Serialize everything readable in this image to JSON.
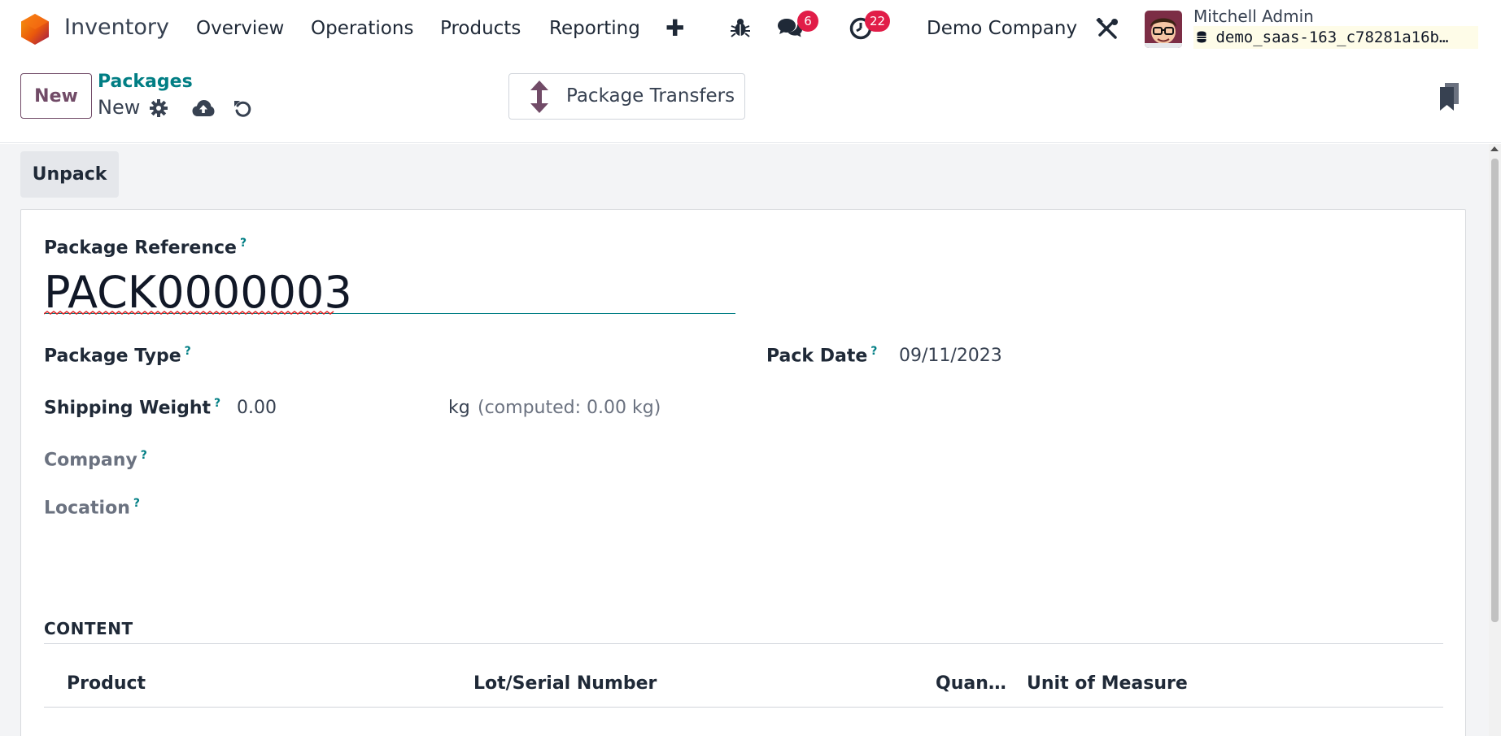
{
  "navbar": {
    "app_name": "Inventory",
    "menu": [
      "Overview",
      "Operations",
      "Products",
      "Reporting"
    ],
    "messages_count": "6",
    "activities_count": "22",
    "company": "Demo Company",
    "user_name": "Mitchell Admin",
    "database": "demo_saas-163_c78281a16b…"
  },
  "control_panel": {
    "new_label": "New",
    "breadcrumb_parent": "Packages",
    "breadcrumb_current": "New",
    "smart_button_label": "Package Transfers"
  },
  "form": {
    "unpack_label": "Unpack",
    "package_reference_label": "Package Reference",
    "package_reference_value": "PACK0000003",
    "help_mark": "?",
    "package_type_label": "Package Type",
    "pack_date_label": "Pack Date",
    "pack_date_value": "09/11/2023",
    "shipping_weight_label": "Shipping Weight",
    "shipping_weight_value": "0.00",
    "weight_unit": "kg",
    "computed_weight": "(computed: 0.00 kg)",
    "company_label": "Company",
    "location_label": "Location"
  },
  "content_section": {
    "title": "CONTENT",
    "columns": [
      "Product",
      "Lot/Serial Number",
      "Quan…",
      "Unit of Measure"
    ]
  },
  "colors": {
    "brand": "#714b67",
    "link": "#017e84",
    "badge": "#e11d48",
    "background": "#f3f4f6"
  },
  "icons": {
    "bug": "bug-icon",
    "chat": "chat-icon",
    "clock": "clock-icon",
    "tools": "tools-icon",
    "gear": "gear-icon",
    "save": "cloud-upload-icon",
    "discard": "undo-icon",
    "transfers": "arrows-updown-icon",
    "bookmark": "bookmark-icon",
    "database": "database-icon"
  }
}
